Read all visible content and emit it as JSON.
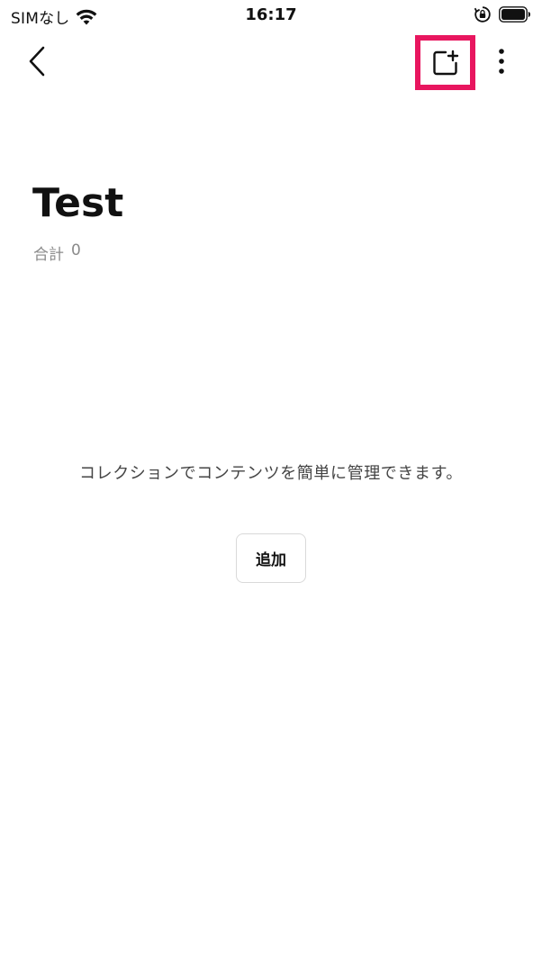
{
  "status_bar": {
    "carrier": "SIMなし",
    "time": "16:17",
    "wifi_icon": "wifi-icon",
    "orientation_lock_icon": "rotation-lock-icon",
    "battery_icon": "battery-icon"
  },
  "nav": {
    "back_icon": "chevron-left-icon",
    "new_item_icon": "new-item-plus-icon",
    "more_icon": "vertical-ellipsis-icon",
    "highlight_color": "#e8165f"
  },
  "collection": {
    "title": "Test",
    "total_label": "合計",
    "total_count": "0"
  },
  "empty_state": {
    "message": "コレクションでコンテンツを簡単に管理できます。",
    "add_label": "追加"
  }
}
